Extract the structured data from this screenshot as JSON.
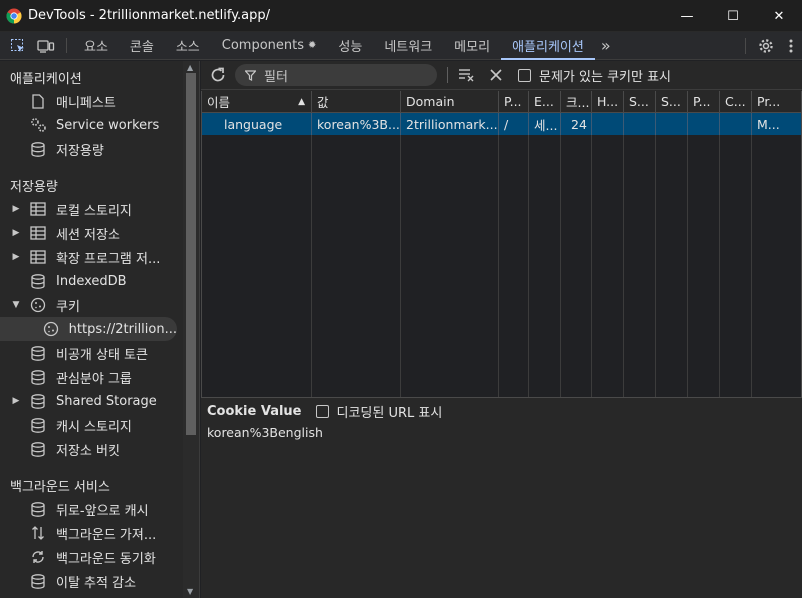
{
  "window": {
    "title": "DevTools - 2trillionmarket.netlify.app/",
    "minimize": "—",
    "maximize": "☐",
    "close": "✕"
  },
  "tabs": [
    {
      "label": "요소"
    },
    {
      "label": "콘솔"
    },
    {
      "label": "소스"
    },
    {
      "label": "Components",
      "icon": "✹"
    },
    {
      "label": "성능"
    },
    {
      "label": "네트워크"
    },
    {
      "label": "메모리"
    },
    {
      "label": "애플리케이션",
      "active": true
    }
  ],
  "tabs_more": "»",
  "sidebar": {
    "app_section": "애플리케이션",
    "app_items": [
      {
        "label": "매니페스트",
        "icon": "file-icon"
      },
      {
        "label": "Service workers",
        "icon": "gears-icon"
      },
      {
        "label": "저장용량",
        "icon": "database-icon"
      }
    ],
    "storage_section": "저장용량",
    "storage_items": [
      {
        "label": "로컬 스토리지",
        "icon": "table-icon",
        "expand": "▶"
      },
      {
        "label": "세션 저장소",
        "icon": "table-icon",
        "expand": "▶"
      },
      {
        "label": "확장 프로그램 저...",
        "icon": "table-icon",
        "expand": "▶"
      },
      {
        "label": "IndexedDB",
        "icon": "database-icon",
        "expand": ""
      },
      {
        "label": "쿠키",
        "icon": "cookie-icon",
        "expand": "▼"
      },
      {
        "label": "https://2trillion...",
        "icon": "cookie-icon",
        "expand": "",
        "selected": true
      },
      {
        "label": "비공개 상태 토큰",
        "icon": "database-icon",
        "expand": ""
      },
      {
        "label": "관심분야 그룹",
        "icon": "database-icon",
        "expand": ""
      },
      {
        "label": "Shared Storage",
        "icon": "database-icon",
        "expand": "▶"
      },
      {
        "label": "캐시 스토리지",
        "icon": "database-icon",
        "expand": ""
      },
      {
        "label": "저장소 버킷",
        "icon": "database-icon",
        "expand": ""
      }
    ],
    "bg_section": "백그라운드 서비스",
    "bg_items": [
      {
        "label": "뒤로-앞으로 캐시",
        "icon": "database-icon"
      },
      {
        "label": "백그라운드 가져...",
        "icon": "updown-icon"
      },
      {
        "label": "백그라운드 동기화",
        "icon": "sync-icon"
      },
      {
        "label": "이탈 추적 감소",
        "icon": "database-icon"
      }
    ]
  },
  "toolbar": {
    "filter_placeholder": "필터",
    "issues_only_label": "문제가 있는 쿠키만 표시"
  },
  "table": {
    "columns": [
      "이름",
      "값",
      "Domain",
      "P...",
      "E...",
      "크...",
      "H...",
      "S...",
      "S...",
      "P...",
      "C...",
      "Pr..."
    ],
    "sort_indicator": "▲",
    "rows": [
      [
        "language",
        "korean%3B...",
        "2trillionmark...",
        "/",
        "세...",
        "24",
        "",
        "",
        "",
        "",
        "",
        "M..."
      ]
    ]
  },
  "cookie_value": {
    "title": "Cookie Value",
    "decode_label": "디코딩된 URL 표시",
    "value": "korean%3Benglish"
  }
}
